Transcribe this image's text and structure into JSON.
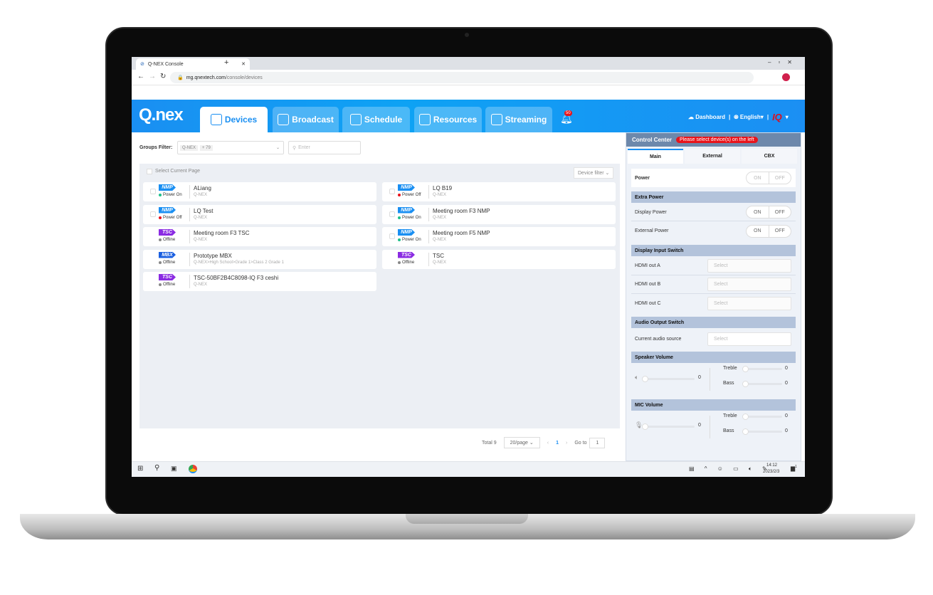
{
  "browser": {
    "tab_title": "Q-NEX Console",
    "url_host": "mg.qnextech.com",
    "url_path": "/console/devices"
  },
  "header": {
    "logo": "Q.nex",
    "tabs": [
      {
        "label": "Devices",
        "active": true
      },
      {
        "label": "Broadcast"
      },
      {
        "label": "Schedule"
      },
      {
        "label": "Resources"
      },
      {
        "label": "Streaming"
      }
    ],
    "notifications": "50",
    "dashboard": "Dashboard",
    "language": "English",
    "user_logo": "IQ",
    "accent": "#1a8ff2"
  },
  "filter": {
    "label": "Groups Filter:",
    "tag": "Q-NEX",
    "more": "+ 79",
    "search_placeholder": "Enter"
  },
  "list": {
    "select_page": "Select Current Page",
    "device_filter": "Device filter",
    "left": [
      {
        "type": "NMP",
        "status": "Power On",
        "name": "ALiang",
        "group": "Q-NEX"
      },
      {
        "type": "NMP",
        "status": "Power Off",
        "name": "LQ Test",
        "group": "Q-NEX"
      },
      {
        "type": "TSC",
        "status": "Offline",
        "name": "Meeting room F3 TSC",
        "group": "Q-NEX"
      },
      {
        "type": "MBX",
        "status": "Offline",
        "name": "Prototype MBX",
        "group": "Q-NEX>High School>Grade 1>Class 2 Grade 1"
      },
      {
        "type": "TSC",
        "status": "Offline",
        "name": "TSC-50BF2B4C8098-IQ F3 ceshi",
        "group": "Q-NEX"
      }
    ],
    "right": [
      {
        "type": "NMP",
        "status": "Power Off",
        "name": "LQ B19",
        "group": "Q-NEX"
      },
      {
        "type": "NMP",
        "status": "Power On",
        "name": "Meeting room F3 NMP",
        "group": "Q-NEX"
      },
      {
        "type": "NMP",
        "status": "Power On",
        "name": "Meeting room F5 NMP",
        "group": "Q-NEX"
      },
      {
        "type": "TSC",
        "status": "Offline",
        "name": "TSC",
        "group": "Q-NEX"
      }
    ]
  },
  "pagination": {
    "total": "Total 9",
    "page_size": "20/page",
    "current": "1",
    "goto_label": "Go to",
    "goto_value": "1"
  },
  "control": {
    "title": "Control Center",
    "warning": "Please select device(s) on the left",
    "tabs": [
      "Main",
      "External",
      "CBX"
    ],
    "power": "Power",
    "on": "ON",
    "off": "OFF",
    "extra_power": "Extra Power",
    "display_power": "Display Power",
    "external_power": "External Power",
    "display_input": "Display Input Switch",
    "hdmi_a": "HDMI out A",
    "hdmi_b": "HDMI out B",
    "hdmi_c": "HDMI out C",
    "select": "Select",
    "audio_output": "Audio Output Switch",
    "audio_source": "Current audio source",
    "speaker": "Speaker Volume",
    "mic": "MIC Volume",
    "treble": "Treble",
    "bass": "Bass",
    "speaker_vol": "0",
    "speaker_treble": "0",
    "speaker_bass": "0",
    "mic_vol": "0",
    "mic_treble": "0",
    "mic_bass": "0"
  },
  "taskbar": {
    "time": "14:12",
    "date": "2023/2/3",
    "notif": "1"
  }
}
